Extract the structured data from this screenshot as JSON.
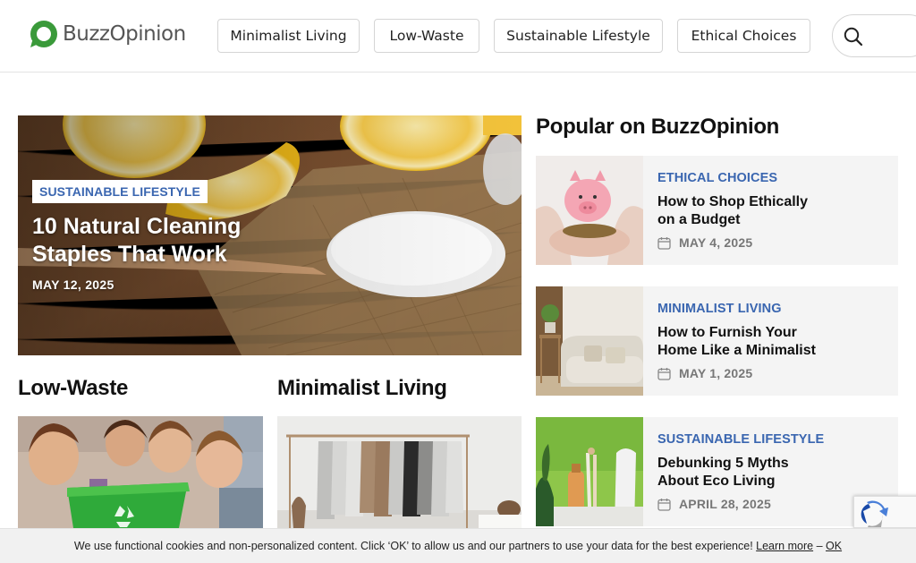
{
  "brand": {
    "name": "BuzzOpinion",
    "accent": "#3a66b0",
    "logo_green": "#3a9a3a"
  },
  "nav": {
    "items": [
      {
        "label": "Minimalist Living"
      },
      {
        "label": "Low-Waste"
      },
      {
        "label": "Sustainable Lifestyle"
      },
      {
        "label": "Ethical Choices"
      }
    ],
    "search_icon": "search-icon"
  },
  "hero": {
    "category": "SUSTAINABLE LIFESTYLE",
    "title": "10 Natural Cleaning Staples That Work",
    "date": "MAY 12, 2025"
  },
  "sections": {
    "low_waste": {
      "title": "Low-Waste"
    },
    "minimalist": {
      "title": "Minimalist Living"
    }
  },
  "popular": {
    "heading": "Popular on BuzzOpinion",
    "items": [
      {
        "category": "ETHICAL CHOICES",
        "title": "How to Shop Ethically on a Budget",
        "date": "MAY 4, 2025"
      },
      {
        "category": "MINIMALIST LIVING",
        "title": "How to Furnish Your Home Like a Minimalist",
        "date": "MAY 1, 2025"
      },
      {
        "category": "SUSTAINABLE LIFESTYLE",
        "title": "Debunking 5 Myths About Eco Living",
        "date": "APRIL 28, 2025"
      }
    ]
  },
  "cookie": {
    "text": "We use functional cookies and non-personalized content. Click ‘OK’ to allow us and our partners to use your data for the best experience!",
    "learn_more": "Learn more",
    "separator": "–",
    "ok": "OK"
  }
}
